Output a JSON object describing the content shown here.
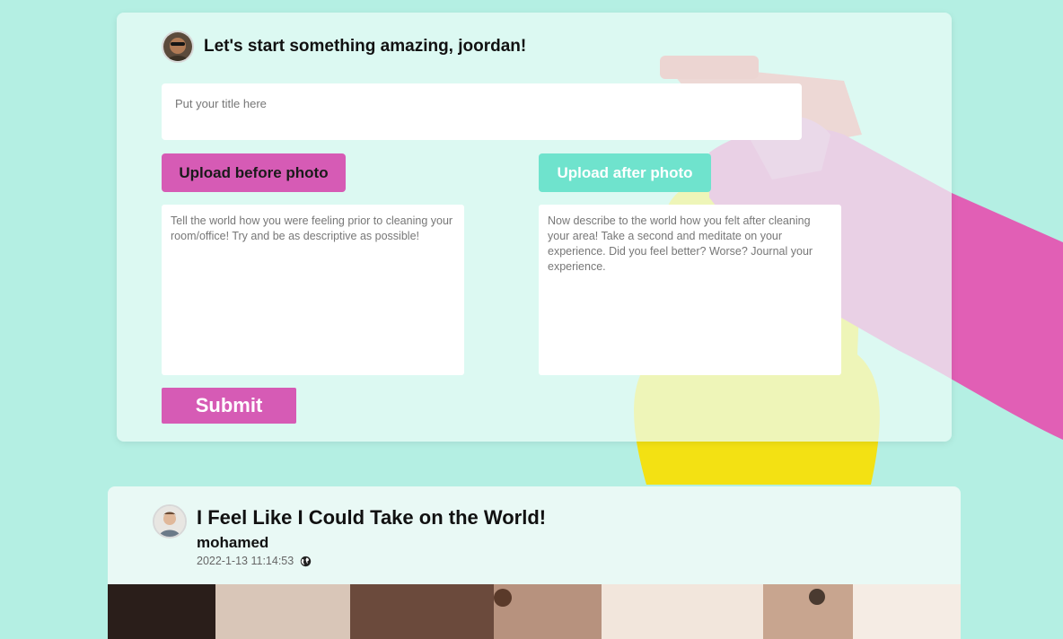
{
  "composer": {
    "greeting": "Let's start something amazing, joordan!",
    "title_placeholder": "Put your title here",
    "upload_before_label": "Upload before photo",
    "upload_after_label": "Upload after photo",
    "before_placeholder": "Tell the world how you were feeling prior to cleaning your room/office! Try and be as descriptive as possible!",
    "after_placeholder": "Now describe to the world how you felt after cleaning your area! Take a second and meditate on your experience. Did you feel better? Worse? Journal your experience.",
    "submit_label": "Submit"
  },
  "post": {
    "title": "I Feel Like I Could Take on the World!",
    "author": "mohamed",
    "timestamp": "2022-1-13 11:14:53",
    "visibility_icon": "globe-icon"
  },
  "colors": {
    "background": "#b4efe3",
    "pink": "#d65bb5",
    "teal": "#6fe3cd"
  }
}
